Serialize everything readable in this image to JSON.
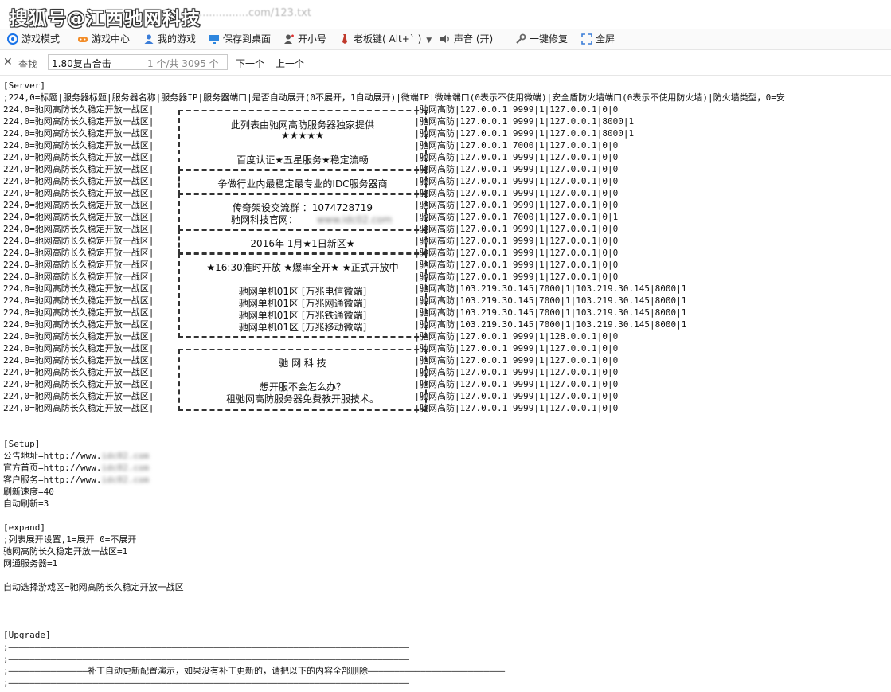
{
  "titlebar": {
    "watermark": "搜狐号@江西驰网科技",
    "url": "...............com/123.txt"
  },
  "toolbar": {
    "items": [
      {
        "label": "游戏模式",
        "icon": "game-mode-icon"
      },
      {
        "label": "游戏中心",
        "icon": "gamepad-icon"
      },
      {
        "label": "我的游戏",
        "icon": "user-icon"
      },
      {
        "label": "保存到桌面",
        "icon": "desktop-icon"
      },
      {
        "label": "开小号",
        "icon": "person-icon"
      },
      {
        "label": "老板键( Alt+` )",
        "icon": "tie-icon"
      },
      {
        "label": "声音 (开)",
        "icon": "speaker-icon"
      },
      {
        "label": "一键修复",
        "icon": "wrench-icon"
      },
      {
        "label": "全屏",
        "icon": "fullscreen-icon"
      }
    ]
  },
  "findbar": {
    "label": "查找",
    "value": "1.80复古合击",
    "count": "1 个/共 3095 个",
    "next": "下一个",
    "prev": "上一个"
  },
  "server": {
    "header": "[Server]",
    "comment": ";224,0=标题|服务器标题|服务器名称|服务器IP|服务器端口|是否自动展开(0不展开，1自动展开)|微端IP|微端端口(0表示不使用微端)|安全盾防火墙端口(0表示不使用防火墙)|防火墙类型，0=安",
    "prefix": "224,0=驰网高防长久稳定开放一战区|",
    "suffixes": [
      "|驰网高防|127.0.0.1|9999|1|127.0.0.1|0|0",
      "|驰网高防|127.0.0.1|9999|1|127.0.0.1|8000|1",
      "|驰网高防|127.0.0.1|9999|1|127.0.0.1|8000|1",
      "|驰网高防|127.0.0.1|7000|1|127.0.0.1|0|0",
      "|驰网高防|127.0.0.1|9999|1|127.0.0.1|0|0",
      "|驰网高防|127.0.0.1|9999|1|127.0.0.1|0|0",
      "|驰网高防|127.0.0.1|9999|1|127.0.0.1|0|0",
      "|驰网高防|127.0.0.1|9999|1|127.0.0.1|0|0",
      "|驰网高防|127.0.0.1|9999|1|127.0.0.1|0|0",
      "|驰网高防|127.0.0.1|7000|1|127.0.0.1|0|1",
      "|驰网高防|127.0.0.1|9999|1|127.0.0.1|0|0",
      "|驰网高防|127.0.0.1|9999|1|127.0.0.1|0|0",
      "|驰网高防|127.0.0.1|9999|1|127.0.0.1|0|0",
      "|驰网高防|127.0.0.1|9999|1|127.0.0.1|0|0",
      "|驰网高防|127.0.0.1|9999|1|127.0.0.1|0|0",
      "|驰网高防|103.219.30.145|7000|1|103.219.30.145|8000|1",
      "|驰网高防|103.219.30.145|7000|1|103.219.30.145|8000|1",
      "|驰网高防|103.219.30.145|7000|1|103.219.30.145|8000|1",
      "|驰网高防|103.219.30.145|7000|1|103.219.30.145|8000|1",
      "|驰网高防|127.0.0.1|9999|1|128.0.0.1|0|0",
      "|驰网高防|127.0.0.1|9999|1|127.0.0.1|0|0",
      "|驰网高防|127.0.0.1|9999|1|127.0.0.1|0|0",
      "|驰网高防|127.0.0.1|9999|1|127.0.0.1|0|0",
      "|驰网高防|127.0.0.1|9999|1|127.0.0.1|0|0",
      "|驰网高防|127.0.0.1|9999|1|127.0.0.1|0|0",
      "|驰网高防|127.0.0.1|9999|1|127.0.0.1|0|0"
    ]
  },
  "banner": {
    "box1": [
      "此列表由驰网高防服务器独家提供",
      "★★★★★",
      "百度认证★五星服务★稳定流畅"
    ],
    "box2": [
      "争做行业内最稳定最专业的IDC服务器商"
    ],
    "box3": [
      "传奇架设交流群  ：1074728719",
      "驰网科技官网：",
      "www.idc02.com"
    ],
    "box4": [
      "2016年  1月★1日新区★"
    ],
    "box5": [
      "★16:30准时开放  ★爆率全开★  ★正式开放中",
      "驰网单机01区    [万兆电信微端]",
      "驰网单机01区    [万兆网通微端]",
      "驰网单机01区    [万兆铁通微端]",
      "驰网单机01区    [万兆移动微端]"
    ],
    "box6": [
      "驰    网    科    技",
      "想开服不会怎么办？",
      "租驰网高防服务器免费教开服技术。"
    ]
  },
  "setup": {
    "header": "[Setup]",
    "lines": [
      {
        "key": "公告地址=http://www.",
        "blur": "idc02.com"
      },
      {
        "key": "官方首页=http://www.",
        "blur": "idc02.com"
      },
      {
        "key": "客户服务=http://www.",
        "blur": "idc02.com"
      }
    ],
    "refresh_speed": "刷新速度=40",
    "auto_refresh": "自动刷新=3"
  },
  "expand": {
    "header": "[expand]",
    "lines": [
      ";列表展开设置,1=展开 0=不展开",
      "驰网高防长久稳定开放一战区=1",
      "网通服务器=1"
    ],
    "auto_select": "自动选择游戏区=驰网高防长久稳定开放一战区"
  },
  "upgrade": {
    "header": "[Upgrade]",
    "dash_line": ";————————————————————————————————————————————————————————————————————————————",
    "note": ";———————————————补丁自动更新配置演示，如果没有补丁更新的，请把以下的内容全部删除——————————————————————————"
  }
}
